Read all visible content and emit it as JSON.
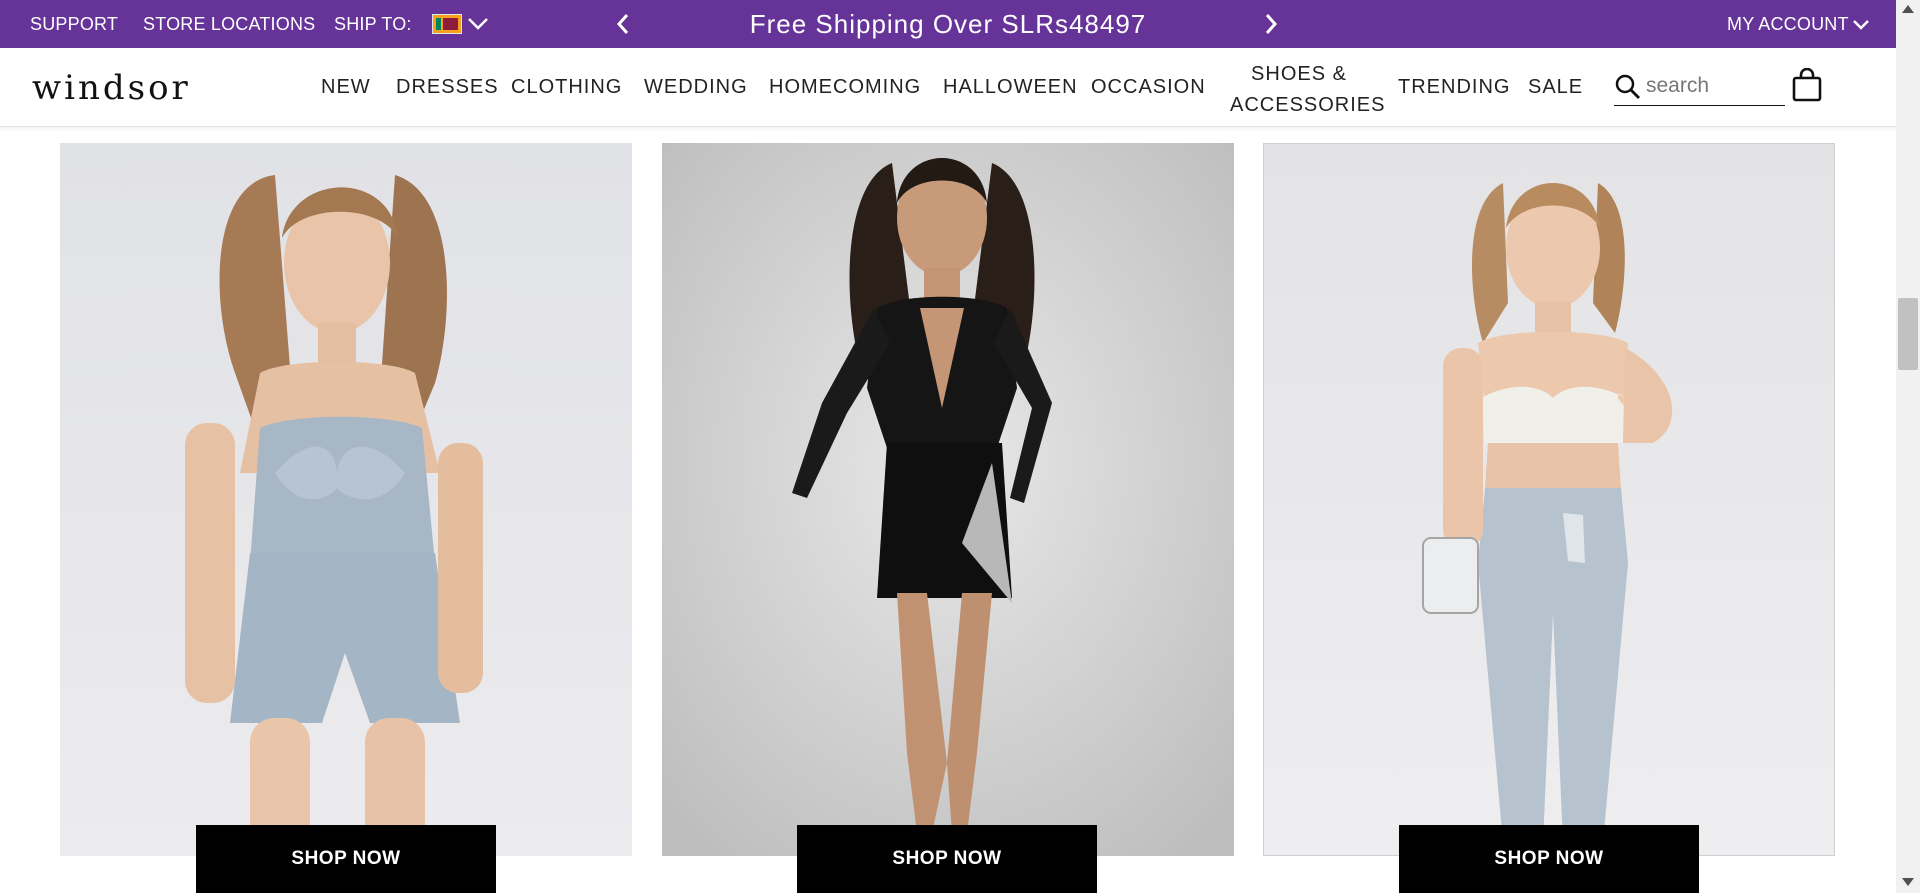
{
  "topbar": {
    "support": "SUPPORT",
    "store_locations": "STORE LOCATIONS",
    "ship_to": "SHIP TO:",
    "promo": "Free Shipping Over SLRs48497",
    "my_account": "MY ACCOUNT",
    "background_color": "#663399"
  },
  "header": {
    "logo": "windsor",
    "nav": [
      "NEW",
      "DRESSES",
      "CLOTHING",
      "WEDDING",
      "HOMECOMING",
      "HALLOWEEN",
      "OCCASION",
      "SHOES &",
      "ACCESSORIES",
      "TRENDING",
      "SALE"
    ],
    "search_placeholder": "search"
  },
  "products": [
    {
      "button_label": "SHOP NOW"
    },
    {
      "button_label": "SHOP NOW"
    },
    {
      "button_label": "SHOP NOW"
    }
  ],
  "icons": [
    "chevron-left-icon",
    "chevron-right-icon",
    "chevron-down-icon",
    "search-icon",
    "shopping-bag-icon",
    "flag-icon"
  ]
}
